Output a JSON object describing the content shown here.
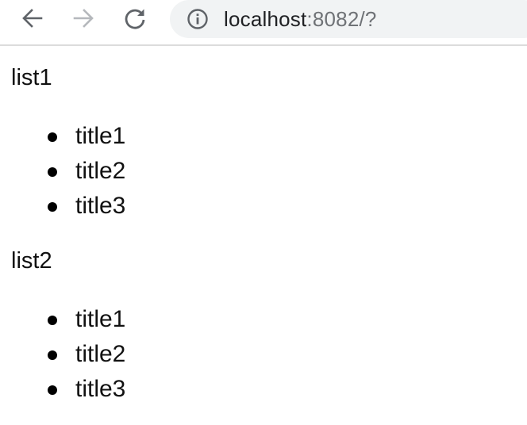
{
  "browser": {
    "url_host": "localhost",
    "url_rest": ":8082/?",
    "icons": {
      "back": "arrow-left-icon",
      "forward": "arrow-right-icon",
      "reload": "reload-icon",
      "info": "info-icon"
    }
  },
  "page": {
    "lists": [
      {
        "heading": "list1",
        "items": [
          "title1",
          "title2",
          "title3"
        ]
      },
      {
        "heading": "list2",
        "items": [
          "title1",
          "title2",
          "title3"
        ]
      }
    ]
  }
}
